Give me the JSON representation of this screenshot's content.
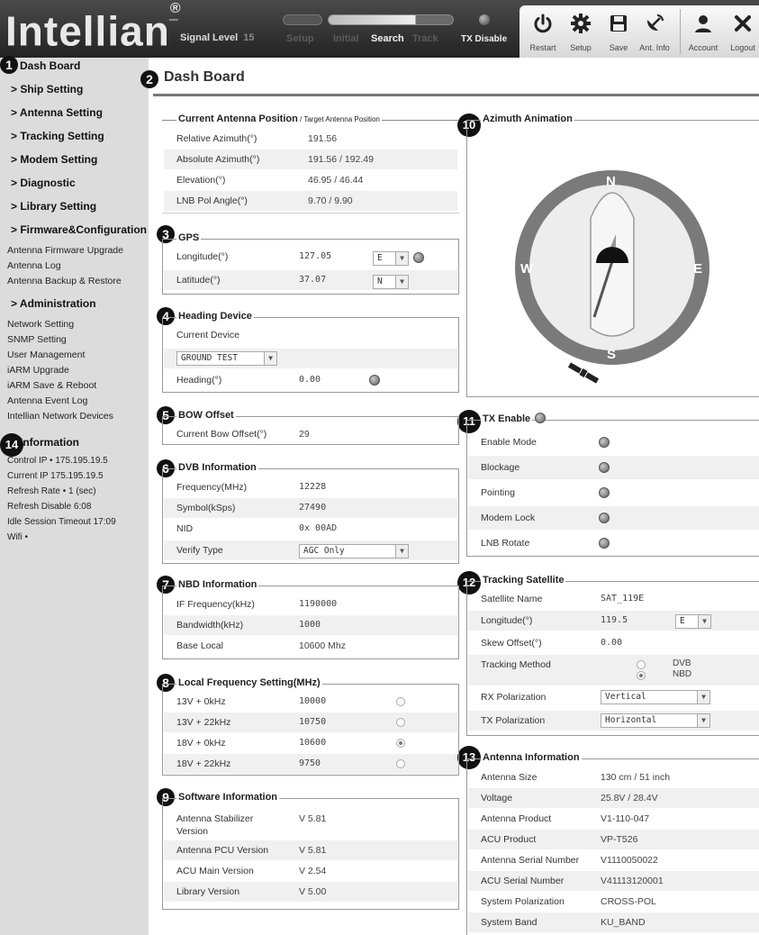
{
  "header": {
    "logo_text": "Intellian",
    "logo_reg": "®",
    "signal_label": "Signal Level",
    "signal_value": "15",
    "steps": [
      "Setup",
      "Initial",
      "Search",
      "Track"
    ],
    "active_step": "Search",
    "tx_label": "TX Disable",
    "tools": [
      {
        "label": "Restart",
        "icon": "power-icon"
      },
      {
        "label": "Setup",
        "icon": "gear-icon"
      },
      {
        "label": "Save",
        "icon": "save-icon"
      },
      {
        "label": "Ant. Info",
        "icon": "antenna-icon"
      },
      {
        "label": "Account",
        "icon": "user-icon"
      },
      {
        "label": "Logout",
        "icon": "close-icon"
      }
    ]
  },
  "sidebar": {
    "dashboard": "Dash Board",
    "ship": "> Ship Setting",
    "antenna": "> Antenna Setting",
    "tracking": "> Tracking Setting",
    "modem": "> Modem Setting",
    "diagnostic": "> Diagnostic",
    "library": "> Library Setting",
    "firmware": "> Firmware&Configuration",
    "firmware_items": [
      "Antenna Firmware Upgrade",
      "Antenna Log",
      "Antenna Backup & Restore"
    ],
    "admin": "> Administration",
    "admin_items": [
      "Network Setting",
      "SNMP Setting",
      "User Management",
      "iARM Upgrade",
      "iARM Save & Reboot",
      "Antenna Event Log",
      "Intellian Network Devices"
    ],
    "info": "Information",
    "info_items": [
      "Control IP • 175.195.19.5",
      "Current IP   175.195.19.5",
      "Refresh Rate •    1 (sec)",
      "Refresh Disable   6:08",
      "Idle Session Timeout  17:09",
      "Wifi  •"
    ]
  },
  "badges": [
    "1",
    "2",
    "3",
    "4",
    "5",
    "6",
    "7",
    "8",
    "9",
    "10",
    "11",
    "12",
    "13",
    "14"
  ],
  "main": {
    "title": "Dash Board",
    "position": {
      "title": "Current Antenna Position",
      "subtitle": " / Target Antenna Position",
      "rows": [
        {
          "label": "Relative Azimuth(°)",
          "value": "191.56"
        },
        {
          "label": "Absolute Azimuth(°)",
          "value": "191.56 / 192.49"
        },
        {
          "label": "Elevation(°)",
          "value": "46.95 / 46.44"
        },
        {
          "label": "LNB Pol Angle(°)",
          "value": "9.70 / 9.90"
        }
      ]
    },
    "gps": {
      "title": "GPS",
      "rows": [
        {
          "label": "Longitude(°)",
          "value": "127.05",
          "dir": "E"
        },
        {
          "label": "Latitude(°)",
          "value": "37.07",
          "dir": "N"
        }
      ]
    },
    "heading": {
      "title": "Heading Device",
      "current_label": "Current Device",
      "device": "GROUND TEST",
      "heading_label": "Heading(°)",
      "heading_value": "0.00"
    },
    "bow": {
      "title": "BOW Offset",
      "label": "Current Bow Offset(°)",
      "value": "29"
    },
    "dvb": {
      "title": "DVB Information",
      "rows": [
        {
          "label": "Frequency(MHz)",
          "value": "12228"
        },
        {
          "label": "Symbol(kSps)",
          "value": "27490"
        },
        {
          "label": "NID",
          "value": "0x 00AD"
        }
      ],
      "verify_label": "Verify Type",
      "verify_value": "AGC Only"
    },
    "nbd": {
      "title": "NBD Information",
      "rows": [
        {
          "label": "IF Frequency(kHz)",
          "value": "1190000"
        },
        {
          "label": "Bandwidth(kHz)",
          "value": "1000"
        },
        {
          "label": "Base Local",
          "value": "10600 Mhz"
        }
      ]
    },
    "lfs": {
      "title": "Local Frequency Setting(MHz)",
      "rows": [
        {
          "label": "13V + 0kHz",
          "value": "10000",
          "selected": false
        },
        {
          "label": "13V + 22kHz",
          "value": "10750",
          "selected": false
        },
        {
          "label": "18V + 0kHz",
          "value": "10600",
          "selected": true
        },
        {
          "label": "18V + 22kHz",
          "value": "9750",
          "selected": false
        }
      ]
    },
    "software": {
      "title": "Software Information",
      "rows": [
        {
          "label": "Antenna Stabilizer Version",
          "value": "V 5.81"
        },
        {
          "label": "Antenna PCU Version",
          "value": "V 5.81"
        },
        {
          "label": "ACU Main Version",
          "value": "V 2.54"
        },
        {
          "label": "Library Version",
          "value": "V 5.00"
        }
      ]
    },
    "azimuth": {
      "title": "Azimuth Animation",
      "n": "N",
      "s": "S",
      "e": "E",
      "w": "W"
    },
    "tx": {
      "title": "TX Enable",
      "rows": [
        "Enable Mode",
        "Blockage",
        "Pointing",
        "Modem Lock",
        "LNB Rotate"
      ]
    },
    "tracking": {
      "title": "Tracking Satellite",
      "sat_label": "Satellite Name",
      "sat_value": "SAT_119E",
      "lon_label": "Longitude(°)",
      "lon_value": "119.5",
      "lon_dir": "E",
      "skew_label": "Skew Offset(°)",
      "skew_value": "0.00",
      "method_label": "Tracking Method",
      "method_dvb": "DVB",
      "method_nbd": "NBD",
      "rx_label": "RX Polarization",
      "rx_value": "Vertical",
      "tx_label": "TX Polarization",
      "tx_value": "Horizontal"
    },
    "antenna_info": {
      "title": "Antenna Information",
      "rows": [
        {
          "label": "Antenna Size",
          "value": "130 cm / 51 inch"
        },
        {
          "label": "Voltage",
          "value": "25.8V / 28.4V"
        },
        {
          "label": "Antenna Product",
          "value": "V1-110-047"
        },
        {
          "label": "ACU Product",
          "value": "VP-T526"
        },
        {
          "label": "Antenna Serial Number",
          "value": "V1110050022"
        },
        {
          "label": "ACU Serial Number",
          "value": "V41113120001"
        },
        {
          "label": "System Polarization",
          "value": "CROSS-POL"
        },
        {
          "label": "System Band",
          "value": "KU_BAND"
        }
      ]
    }
  }
}
